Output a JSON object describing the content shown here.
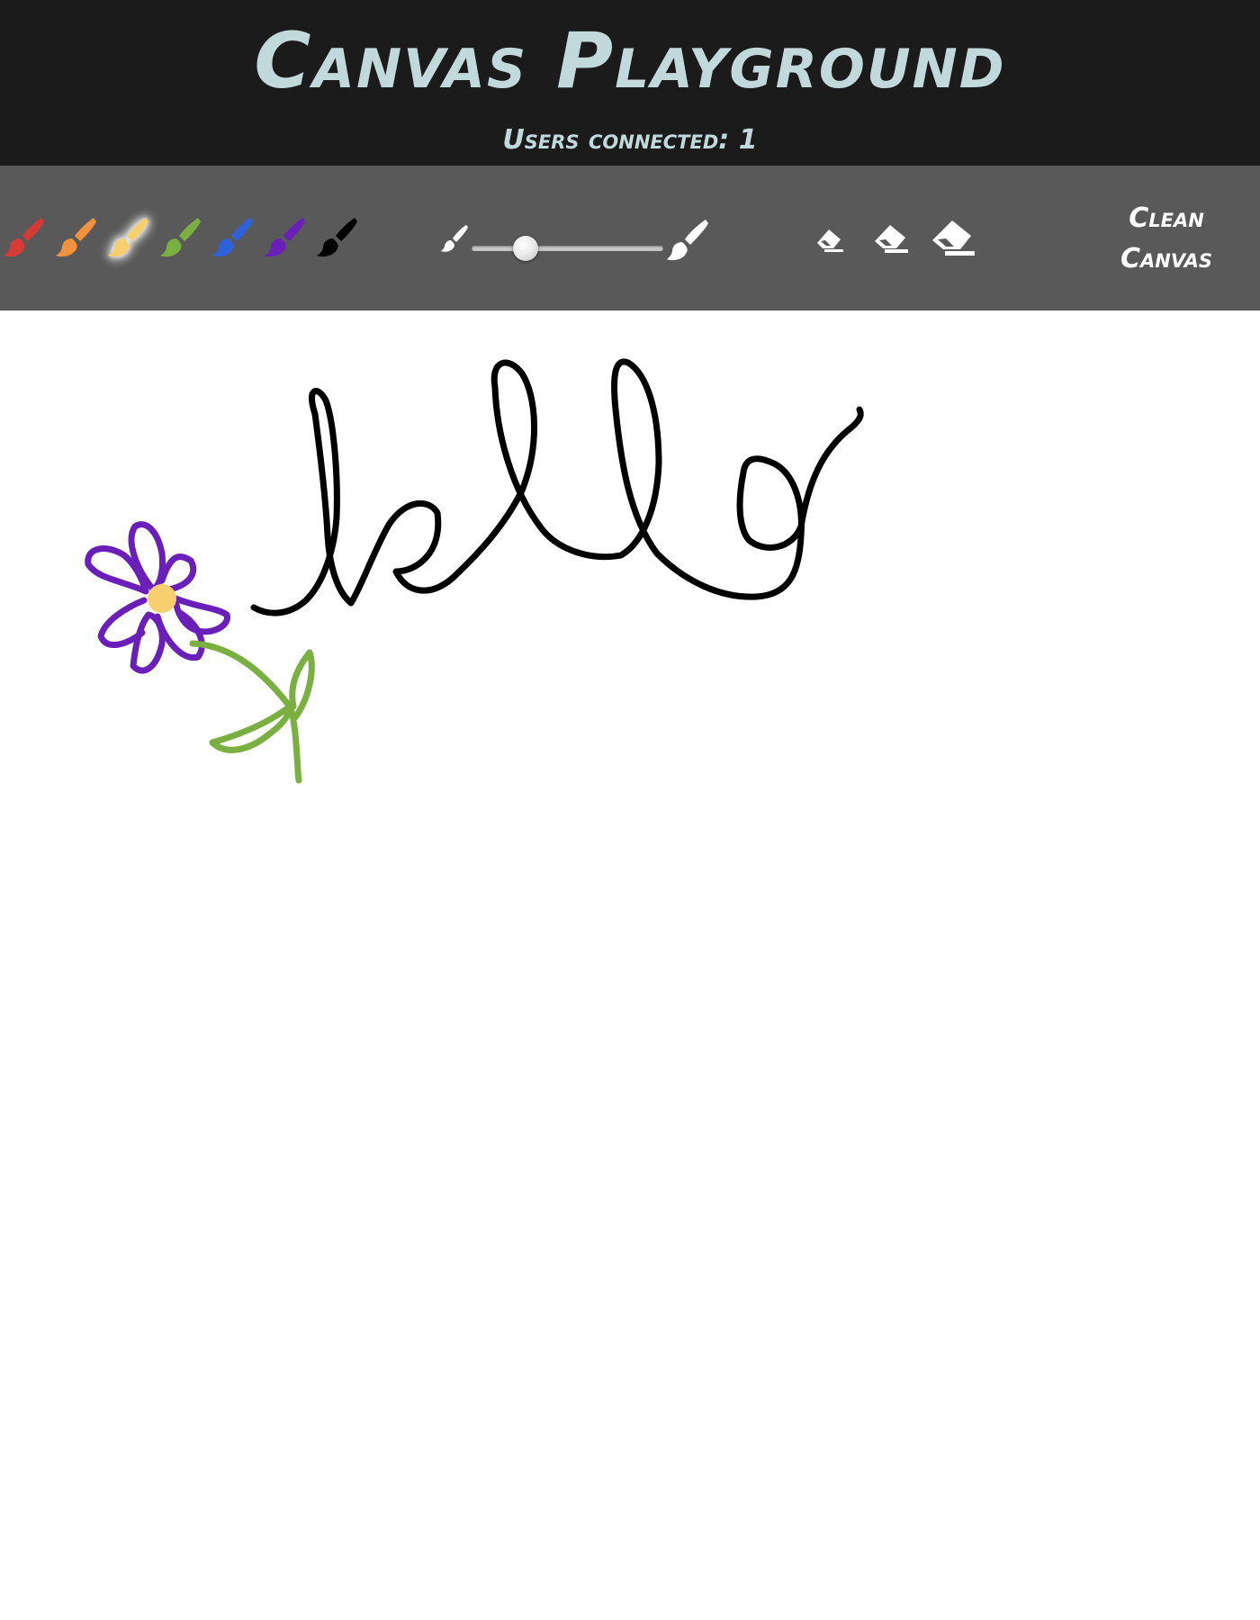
{
  "header": {
    "title": "Canvas Playground",
    "users_label": "Users connected: 1"
  },
  "toolbar": {
    "brushes": [
      {
        "name": "red",
        "color": "#d63a35"
      },
      {
        "name": "orange",
        "color": "#f2923d"
      },
      {
        "name": "yellow",
        "color": "#f7cf6e",
        "selected": true
      },
      {
        "name": "green",
        "color": "#7ab041"
      },
      {
        "name": "blue",
        "color": "#2f62da"
      },
      {
        "name": "purple",
        "color": "#6a1fb8"
      },
      {
        "name": "black",
        "color": "#000000"
      }
    ],
    "brush_size": 0.25,
    "size_small_icon": "brush-small-icon",
    "size_large_icon": "brush-large-icon",
    "erasers": [
      "eraser-small-icon",
      "eraser-medium-icon",
      "eraser-large-icon"
    ],
    "clean_label_line1": "Clean",
    "clean_label_line2": "Canvas"
  },
  "canvas": {
    "background": "#ffffff",
    "drawing": "hello with a flower"
  }
}
